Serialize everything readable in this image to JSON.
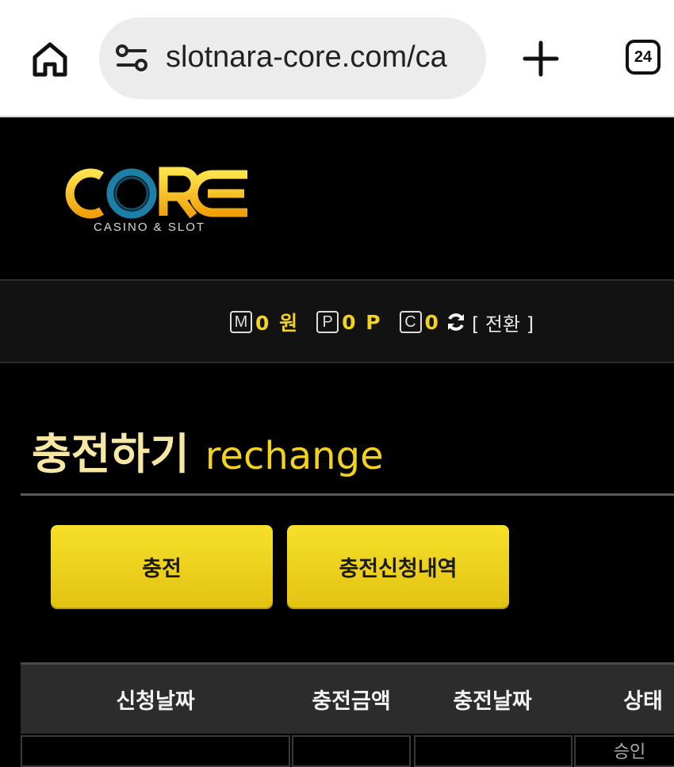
{
  "browser": {
    "url": "slotnara-core.com/ca",
    "tab_count": "24"
  },
  "logo": {
    "wordmark": "CORE",
    "tagline": "CASINO & SLOT"
  },
  "balance": {
    "money_badge": "M",
    "money_value": "0 원",
    "point_badge": "P",
    "point_value": "0 P",
    "coin_badge": "C",
    "coin_value": "0",
    "switch_label": "[ 전환 ]"
  },
  "page": {
    "title_ko": "충전하기",
    "title_en": "rechange"
  },
  "buttons": {
    "recharge": "충전",
    "history": "충전신청내역"
  },
  "table": {
    "headers": [
      "신청날짜",
      "충전금액",
      "충전날짜",
      "상태"
    ],
    "first_row_status": "승인"
  },
  "colors": {
    "accent_yellow": "#f2d21e",
    "background": "#000000",
    "header_bg": "#2c2c2c"
  }
}
